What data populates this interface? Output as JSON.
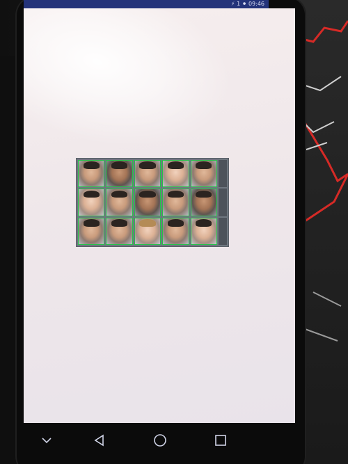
{
  "status_bar": {
    "text": "⚡ 1 ⚫ 09:46"
  },
  "screen": {
    "photo": {
      "rows": 3,
      "columns": 5
    }
  },
  "nav": {
    "icons": [
      "chevron-down-icon",
      "back-triangle-icon",
      "home-circle-icon",
      "recents-square-icon"
    ]
  },
  "colors": {
    "status_bar": "#24337a",
    "screen_bg": "#f4ecee",
    "detection_box": "#27c24a"
  }
}
